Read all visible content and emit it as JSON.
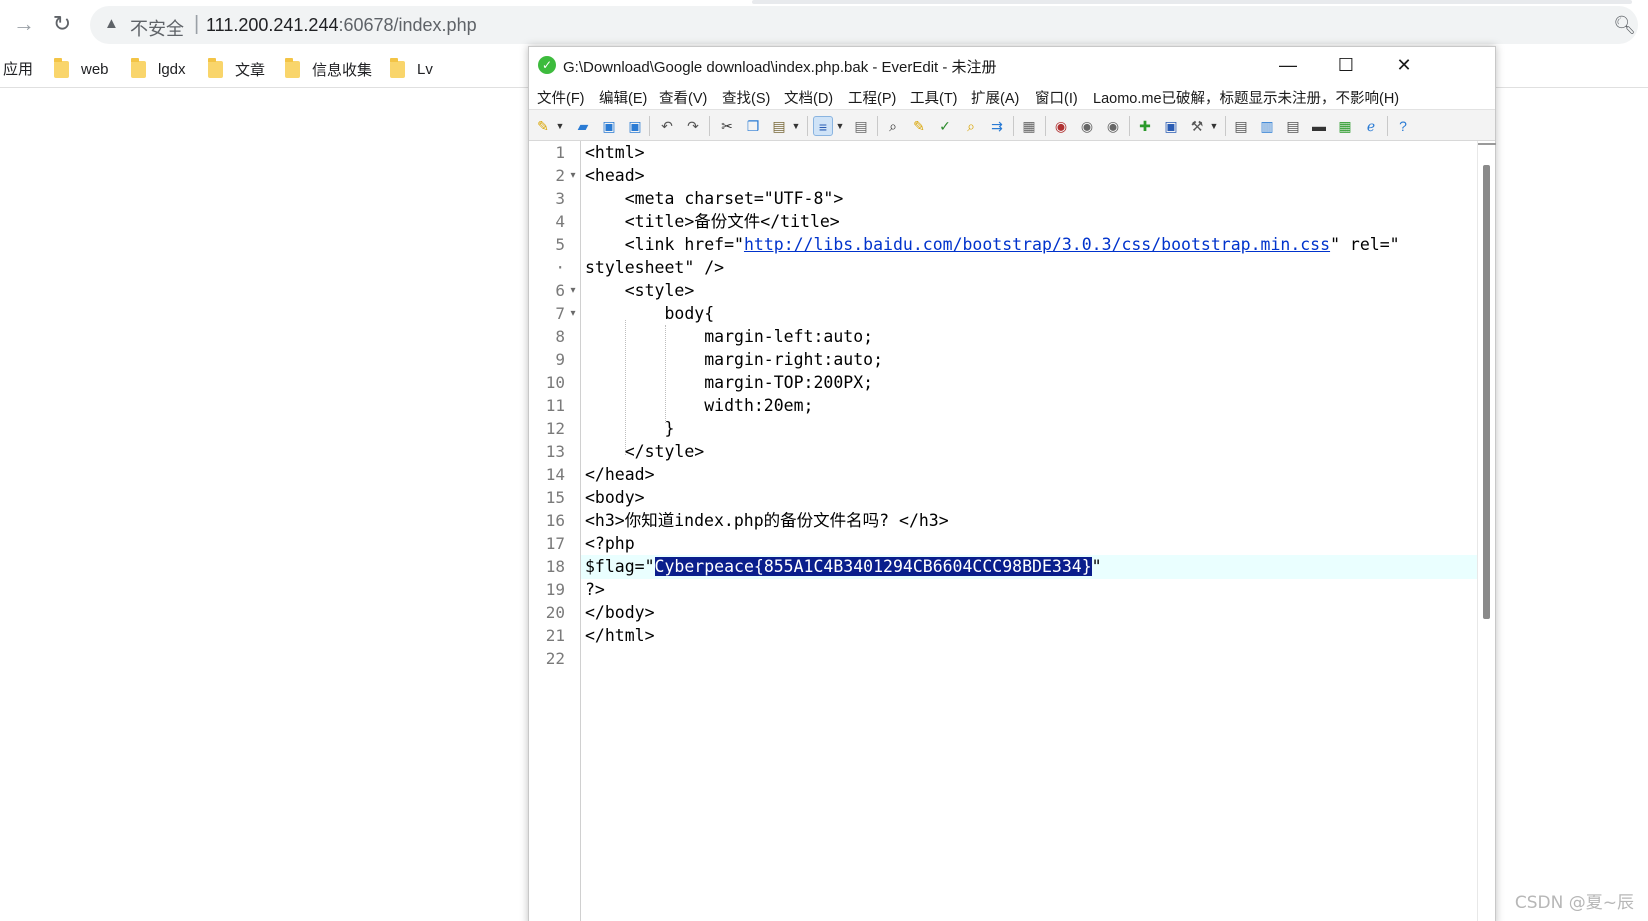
{
  "browser": {
    "insecure_label": "不安全",
    "separator": "|",
    "url_host": "111.200.241.244",
    "url_rest": ":60678/index.php",
    "apps_label": "应用",
    "bookmarks": [
      {
        "label": "web"
      },
      {
        "label": "lgdx"
      },
      {
        "label": "文章"
      },
      {
        "label": "信息收集"
      },
      {
        "label": "Lv"
      }
    ]
  },
  "window": {
    "title": "G:\\Download\\Google download\\index.php.bak - EverEdit - 未注册",
    "minimize": "—",
    "maximize": "☐",
    "close": "✕"
  },
  "menu": [
    {
      "label": "文件(F)"
    },
    {
      "label": "编辑(E)"
    },
    {
      "label": "查看(V)"
    },
    {
      "label": "查找(S)"
    },
    {
      "label": "文档(D)"
    },
    {
      "label": "工程(P)"
    },
    {
      "label": "工具(T)"
    },
    {
      "label": "扩展(A)"
    },
    {
      "label": "窗口(I)"
    },
    {
      "label": "Laomo.me已破解，标题显示未注册，不影响(H)"
    }
  ],
  "editor": {
    "lines": [
      {
        "num": "1",
        "fold": "",
        "text": "<html>"
      },
      {
        "num": "2",
        "fold": "▾",
        "text": "<head>"
      },
      {
        "num": "3",
        "fold": "",
        "text": "    <meta charset=\"UTF-8\">"
      },
      {
        "num": "4",
        "fold": "",
        "text": "    <title>备份文件</title>"
      },
      {
        "num": "5",
        "fold": "",
        "pre": "    <link href=\"",
        "link": "http://libs.baidu.com/bootstrap/3.0.3/css/bootstrap.min.css",
        "post": "\" rel=\""
      },
      {
        "num": "·",
        "fold": "",
        "text": "stylesheet\" />"
      },
      {
        "num": "6",
        "fold": "▾",
        "text": "    <style>"
      },
      {
        "num": "7",
        "fold": "▾",
        "text": "        body{"
      },
      {
        "num": "8",
        "fold": "",
        "text": "            margin-left:auto;"
      },
      {
        "num": "9",
        "fold": "",
        "text": "            margin-right:auto;"
      },
      {
        "num": "10",
        "fold": "",
        "text": "            margin-TOP:200PX;"
      },
      {
        "num": "11",
        "fold": "",
        "text": "            width:20em;"
      },
      {
        "num": "12",
        "fold": "",
        "text": "        }"
      },
      {
        "num": "13",
        "fold": "",
        "text": "    </style>"
      },
      {
        "num": "14",
        "fold": "",
        "text": "</head>"
      },
      {
        "num": "15",
        "fold": "",
        "text": "<body>"
      },
      {
        "num": "16",
        "fold": "",
        "text": "<h3>你知道index.php的备份文件名吗? </h3>"
      },
      {
        "num": "17",
        "fold": "",
        "text": "<?php"
      },
      {
        "num": "18",
        "fold": "",
        "pre": "$flag=\"",
        "sel": "Cyberpeace{855A1C4B3401294CB6604CCC98BDE334}",
        "post": "\""
      },
      {
        "num": "19",
        "fold": "",
        "text": "?>"
      },
      {
        "num": "20",
        "fold": "",
        "text": "</body>"
      },
      {
        "num": "21",
        "fold": "",
        "text": "</html>"
      },
      {
        "num": "22",
        "fold": "",
        "text": ""
      }
    ]
  },
  "watermark": "CSDN @夏~辰"
}
